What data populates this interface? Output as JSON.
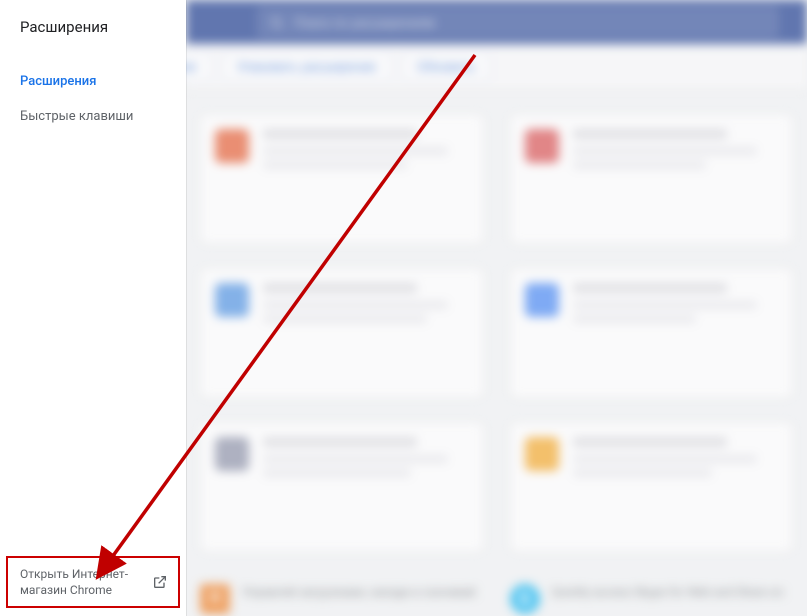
{
  "sidebar": {
    "title": "Расширения",
    "items": [
      {
        "label": "Расширения",
        "active": true
      },
      {
        "label": "Быстрые клавиши",
        "active": false
      }
    ],
    "webstore": {
      "line1": "Открыть Интернет-",
      "line2": "магазин Chrome"
    }
  },
  "search": {
    "placeholder": "Поиск по расширениям"
  },
  "actions": {
    "load_unpacked_partial": "ние",
    "pack": "Упаковать расширение",
    "update": "Обновить"
  },
  "bottom": {
    "dl_desc": "Управляй загрузками, находи и скачивай",
    "skype_title_tail": "10.2.0.9900",
    "skype_desc": "Quickly access Skype for Web and Share on"
  },
  "colors": {
    "accent": "#1a73e8",
    "toolbar": "#14358b",
    "annotation": "#c00000"
  }
}
